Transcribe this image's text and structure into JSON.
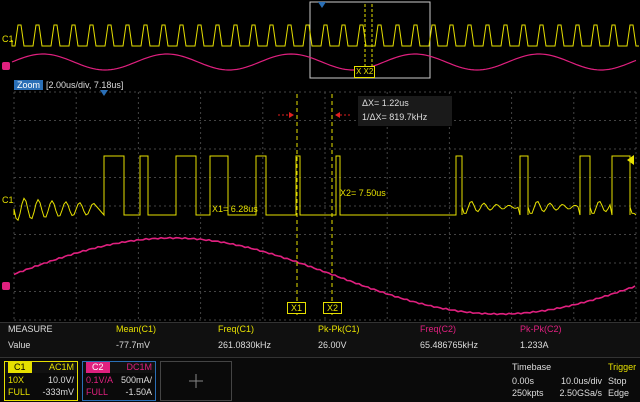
{
  "zoom": {
    "tag": "Zoom",
    "info": "[2.00us/div, 7.18us]"
  },
  "cursors": {
    "delta_x": "ΔX= 1.22us",
    "inv_delta_x": "1/ΔX= 819.7kHz",
    "x1_value": "X1= 6.28us",
    "x2_value": "X2= 7.50us",
    "x1_tag": "X1",
    "x2_tag": "X2",
    "overview_tag": "X X2"
  },
  "channels": {
    "c1_marker": "C1",
    "c2_marker": "C2"
  },
  "measure": {
    "header": [
      "MEASURE",
      "Mean(C1)",
      "Freq(C1)",
      "Pk-Pk(C1)",
      "Freq(C2)",
      "Pk-Pk(C2)"
    ],
    "values": [
      "Value",
      "-77.7mV",
      "261.0830kHz",
      "26.00V",
      "65.486765kHz",
      "1.233A"
    ]
  },
  "ch1": {
    "name": "C1",
    "coupling": "AC1M",
    "probe": "10X",
    "scale": "10.0V/",
    "bw": "FULL",
    "offset": "-333mV"
  },
  "ch2": {
    "name": "C2",
    "coupling": "DC1M",
    "probe": "0.1V/A",
    "scale": "500mA/",
    "bw": "FULL",
    "offset": "-1.50A"
  },
  "timebase": {
    "title": "Timebase",
    "delay": "0.00s",
    "scale": "10.0us/div",
    "points": "250kpts",
    "rate": "2.50GSa/s"
  },
  "trigger": {
    "title": "Trigger",
    "state": "Stop",
    "type": "Edge"
  },
  "colors": {
    "ch1": "#e6e000",
    "ch2": "#e0207f",
    "accent": "#2a6fb6"
  }
}
